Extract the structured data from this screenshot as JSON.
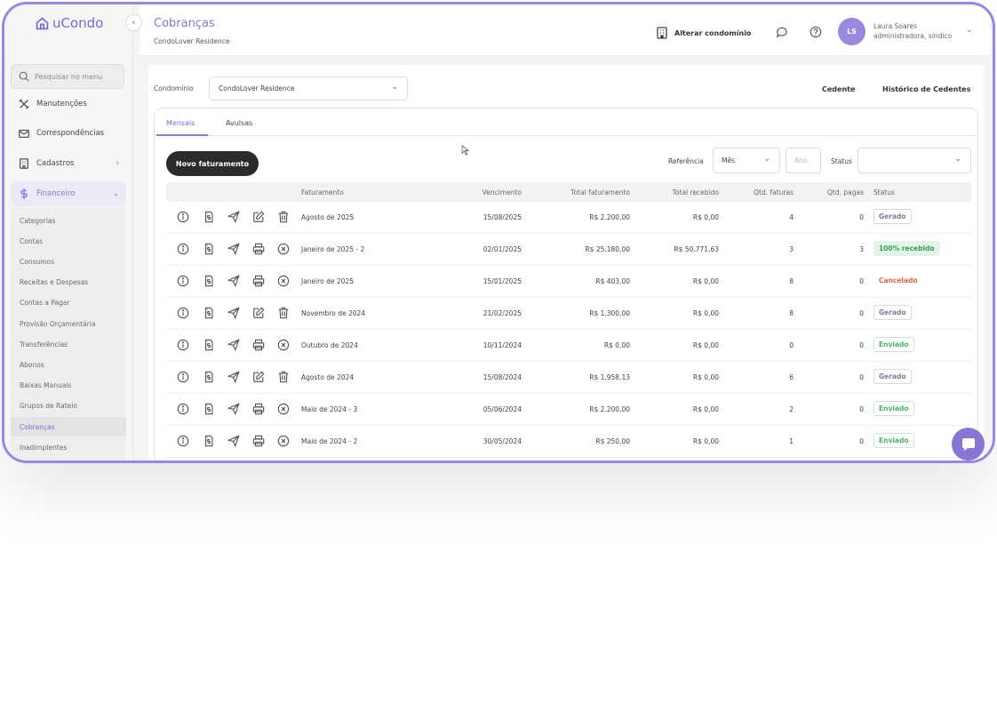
{
  "app": {
    "logo_text": "uCondo"
  },
  "sidebar": {
    "search_placeholder": "Pesquisar no menu",
    "items": [
      {
        "label": "Manutenções",
        "icon": "tools-icon"
      },
      {
        "label": "Correspondências",
        "icon": "mail-icon"
      },
      {
        "label": "Cadastros",
        "icon": "building-icon"
      },
      {
        "label": "Financeiro",
        "icon": "dollar-icon"
      }
    ],
    "submenu": [
      "Categorias",
      "Contas",
      "Consumos",
      "Receitas e Despesas",
      "Contas a Pagar",
      "Provisão Orçamentária",
      "Transferências",
      "Abonos",
      "Baixas Manuais",
      "Grupos de Rateio",
      "Cobranças",
      "Inadimplentes"
    ],
    "active_submenu": "Cobranças"
  },
  "header": {
    "title": "Cobranças",
    "subtitle": "CondoLover Residence",
    "change_condo": "Alterar condomínio",
    "user": {
      "initials": "LS",
      "name": "Laura Soares",
      "role": "administradora, síndico"
    }
  },
  "filters": {
    "condominio_label": "Condomínio",
    "condominio_value": "CondoLover Residence",
    "cedente_link": "Cedente",
    "historico_link": "Histórico de Cedentes",
    "referencia_label": "Referência",
    "mes_value": "Mês",
    "ano_placeholder": "Ano",
    "status_label": "Status",
    "status_value": ""
  },
  "tabs": [
    "Mensais",
    "Avulsas"
  ],
  "new_button": "Novo faturamento",
  "table": {
    "columns": [
      "Faturamento",
      "Vencimento",
      "Total faturamento",
      "Total recebido",
      "Qtd. faturas",
      "Qtd. pagas",
      "Status"
    ],
    "rows": [
      {
        "faturamento": "Agosto de 2025",
        "vencimento": "15/08/2025",
        "total_faturamento": "R$ 2.200,00",
        "total_recebido": "R$ 0,00",
        "qtd_faturas": "4",
        "qtd_pagas": "0",
        "status": "Gerado",
        "editable": true
      },
      {
        "faturamento": "Janeiro de 2025 - 2",
        "vencimento": "02/01/2025",
        "total_faturamento": "R$ 25.180,00",
        "total_recebido": "R$ 50.771,63",
        "qtd_faturas": "3",
        "qtd_pagas": "3",
        "status": "100% recebido",
        "editable": false
      },
      {
        "faturamento": "Janeiro de 2025",
        "vencimento": "15/01/2025",
        "total_faturamento": "R$ 403,00",
        "total_recebido": "R$ 0,00",
        "qtd_faturas": "8",
        "qtd_pagas": "0",
        "status": "Cancelado",
        "editable": false
      },
      {
        "faturamento": "Novembro de 2024",
        "vencimento": "21/02/2025",
        "total_faturamento": "R$ 1.300,00",
        "total_recebido": "R$ 0,00",
        "qtd_faturas": "8",
        "qtd_pagas": "0",
        "status": "Gerado",
        "editable": true
      },
      {
        "faturamento": "Outubro de 2024",
        "vencimento": "10/11/2024",
        "total_faturamento": "R$ 0,00",
        "total_recebido": "R$ 0,00",
        "qtd_faturas": "0",
        "qtd_pagas": "0",
        "status": "Enviado",
        "editable": false
      },
      {
        "faturamento": "Agosto de 2024",
        "vencimento": "15/08/2024",
        "total_faturamento": "R$ 1.958,13",
        "total_recebido": "R$ 0,00",
        "qtd_faturas": "6",
        "qtd_pagas": "0",
        "status": "Gerado",
        "editable": true
      },
      {
        "faturamento": "Maio de 2024 - 3",
        "vencimento": "05/06/2024",
        "total_faturamento": "R$ 2.200,00",
        "total_recebido": "R$ 0,00",
        "qtd_faturas": "2",
        "qtd_pagas": "0",
        "status": "Enviado",
        "editable": false
      },
      {
        "faturamento": "Maio de 2024 - 2",
        "vencimento": "30/05/2024",
        "total_faturamento": "R$ 250,00",
        "total_recebido": "R$ 0,00",
        "qtd_faturas": "1",
        "qtd_pagas": "0",
        "status": "Enviado",
        "editable": false
      }
    ]
  },
  "colors": {
    "accent": "#8a75d4",
    "gerado": "#7c7c95",
    "recebido": "#3a9a5c",
    "recebido_bg": "#e2f5e8",
    "cancelado": "#e0654b",
    "enviado": "#4caf6a"
  }
}
